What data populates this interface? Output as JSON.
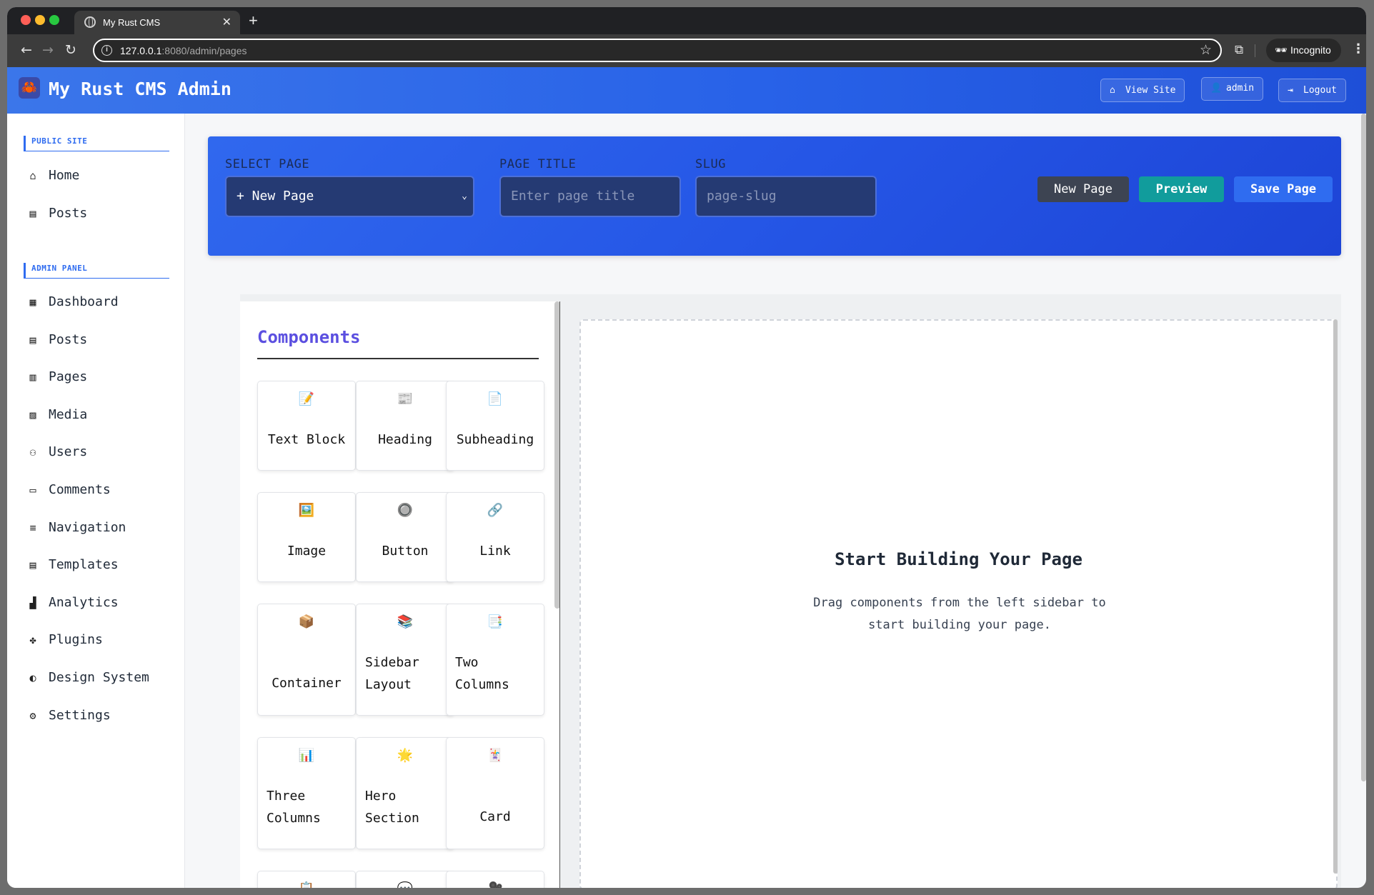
{
  "browser": {
    "tab_title": "My Rust CMS",
    "url_host": "127.0.0.1",
    "url_rest": ":8080/admin/pages",
    "profile_label": "Incognito"
  },
  "header": {
    "title": "My Rust CMS Admin",
    "view_site": "View Site",
    "user": "admin",
    "logout": "Logout"
  },
  "sidebar": {
    "public_title": "PUBLIC SITE",
    "public_items": [
      {
        "label": "Home",
        "icon": "home-icon"
      },
      {
        "label": "Posts",
        "icon": "document-icon"
      }
    ],
    "admin_title": "ADMIN PANEL",
    "admin_items": [
      {
        "label": "Dashboard",
        "icon": "dashboard-icon"
      },
      {
        "label": "Posts",
        "icon": "document-icon"
      },
      {
        "label": "Pages",
        "icon": "page-icon"
      },
      {
        "label": "Media",
        "icon": "image-icon"
      },
      {
        "label": "Users",
        "icon": "users-icon"
      },
      {
        "label": "Comments",
        "icon": "comment-icon"
      },
      {
        "label": "Navigation",
        "icon": "menu-icon"
      },
      {
        "label": "Templates",
        "icon": "template-icon"
      },
      {
        "label": "Analytics",
        "icon": "analytics-icon"
      },
      {
        "label": "Plugins",
        "icon": "puzzle-icon"
      },
      {
        "label": "Design System",
        "icon": "palette-icon"
      },
      {
        "label": "Settings",
        "icon": "gear-icon"
      }
    ]
  },
  "controls": {
    "select_label": "SELECT PAGE",
    "select_value": "+ New Page",
    "title_label": "PAGE TITLE",
    "title_placeholder": "Enter page title",
    "slug_label": "SLUG",
    "slug_placeholder": "page-slug",
    "new_page": "New Page",
    "preview": "Preview",
    "save_page": "Save Page"
  },
  "components": {
    "heading": "Components",
    "items": [
      {
        "label": "Text Block",
        "icon": "📝"
      },
      {
        "label": "Heading",
        "icon": "📰"
      },
      {
        "label": "Subheading",
        "icon": "📄"
      },
      {
        "label": "Image",
        "icon": "🖼️"
      },
      {
        "label": "Button",
        "icon": "🔘"
      },
      {
        "label": "Link",
        "icon": "🔗"
      },
      {
        "label": "Container",
        "icon": "📦"
      },
      {
        "label": "Sidebar Layout",
        "icon": "📚"
      },
      {
        "label": "Two Columns",
        "icon": "📑"
      },
      {
        "label": "Three Columns",
        "icon": "📊"
      },
      {
        "label": "Hero Section",
        "icon": "🌟"
      },
      {
        "label": "Card",
        "icon": "🃏"
      },
      {
        "label": "",
        "icon": "📋"
      },
      {
        "label": "",
        "icon": "💬"
      },
      {
        "label": "",
        "icon": "🎥"
      }
    ]
  },
  "canvas": {
    "title": "Start Building Your Page",
    "text": "Drag components from the left sidebar to start building your page."
  }
}
